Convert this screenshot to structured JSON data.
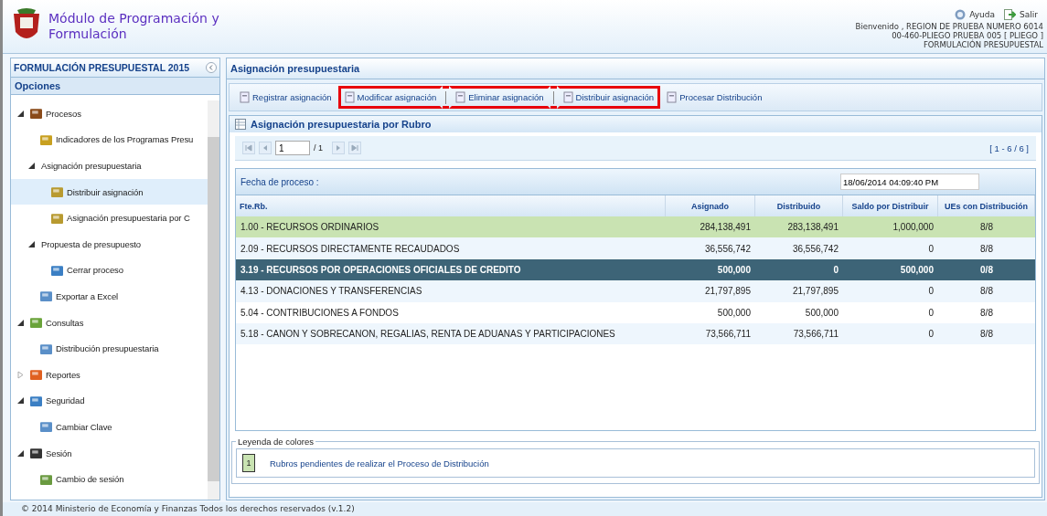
{
  "header": {
    "title_line_1": "Módulo de Programación y",
    "title_line_2": "Formulación",
    "help": "Ayuda",
    "logout": "Salir",
    "user_lines": [
      "Bienvenido , REGION DE PRUEBA NUMERO 6014",
      "00-460-PLIEGO PRUEBA 005 [ PLIEGO ]",
      "FORMULACIÓN PRESUPUESTAL"
    ]
  },
  "sidebar": {
    "title": "FORMULACIÓN PRESUPUESTAL 2015",
    "section": "Opciones",
    "items": [
      {
        "label": "Procesos",
        "expanded": true,
        "selected": false,
        "children": [
          {
            "label": "Indicadores de los Programas Presu",
            "selected": false
          },
          {
            "label": "Asignación presupuestaria",
            "expanded": true,
            "selected": false,
            "children": [
              {
                "label": "Distribuir asignación",
                "selected": true
              },
              {
                "label": "Asignación presupuestaria por C",
                "selected": false
              }
            ]
          },
          {
            "label": "Propuesta de presupuesto",
            "expanded": true,
            "selected": false,
            "children": [
              {
                "label": "Cerrar proceso",
                "selected": false
              }
            ]
          },
          {
            "label": "Exportar a Excel",
            "selected": false
          }
        ]
      },
      {
        "label": "Consultas",
        "expanded": true,
        "selected": false,
        "children": [
          {
            "label": "Distribución presupuestaria",
            "selected": false
          }
        ]
      },
      {
        "label": "Reportes",
        "expanded": false,
        "selected": false
      },
      {
        "label": "Seguridad",
        "expanded": true,
        "selected": false,
        "children": [
          {
            "label": "Cambiar Clave",
            "selected": false
          }
        ]
      },
      {
        "label": "Sesión",
        "expanded": true,
        "selected": false,
        "children": [
          {
            "label": "Cambio de sesión",
            "selected": false
          }
        ]
      }
    ]
  },
  "main": {
    "title": "Asignación presupuestaria",
    "toolbar": [
      {
        "label": "Registrar asignación",
        "highlighted": false
      },
      {
        "label": "Modificar asignación",
        "highlighted": true
      },
      {
        "label": "Eliminar asignación",
        "highlighted": true
      },
      {
        "label": "Distribuir asignación",
        "highlighted": true
      },
      {
        "label": "Procesar Distribución",
        "highlighted": false
      }
    ],
    "panel_title": "Asignación presupuestaria por Rubro",
    "pager": {
      "page": "1",
      "total": "/ 1",
      "range": "[ 1 - 6 / 6 ]"
    },
    "date_label": "Fecha de proceso :",
    "date_value": "18/06/2014 04:09:40 PM",
    "table": {
      "columns": [
        "Fte.Rb.",
        "Asignado",
        "Distribuido",
        "Saldo por Distribuir",
        "UEs con Distribución"
      ],
      "rows": [
        {
          "cells": [
            "1.00 - RECURSOS ORDINARIOS",
            "284,138,491",
            "283,138,491",
            "1,000,000",
            "8/8"
          ],
          "pending": true,
          "selected": false
        },
        {
          "cells": [
            "2.09 - RECURSOS DIRECTAMENTE RECAUDADOS",
            "36,556,742",
            "36,556,742",
            "0",
            "8/8"
          ],
          "pending": false,
          "selected": false
        },
        {
          "cells": [
            "3.19 - RECURSOS POR OPERACIONES OFICIALES DE CREDITO",
            "500,000",
            "0",
            "500,000",
            "0/8"
          ],
          "pending": false,
          "selected": true
        },
        {
          "cells": [
            "4.13 - DONACIONES Y TRANSFERENCIAS",
            "21,797,895",
            "21,797,895",
            "0",
            "8/8"
          ],
          "pending": false,
          "selected": false
        },
        {
          "cells": [
            "5.04 - CONTRIBUCIONES A FONDOS",
            "500,000",
            "500,000",
            "0",
            "8/8"
          ],
          "pending": false,
          "selected": false
        },
        {
          "cells": [
            "5.18 - CANON Y SOBRECANON, REGALIAS, RENTA DE ADUANAS Y PARTICIPACIONES",
            "73,566,711",
            "73,566,711",
            "0",
            "8/8"
          ],
          "pending": false,
          "selected": false
        }
      ]
    },
    "legend": {
      "title": "Leyenda de colores",
      "items": [
        {
          "number": "1",
          "text": "Rubros pendientes de realizar el Proceso de Distribución",
          "color": "#c9e3b2"
        }
      ]
    }
  },
  "footer": "© 2014 Ministerio de Economía y Finanzas Todos los derechos reservados (v.1.2)"
}
